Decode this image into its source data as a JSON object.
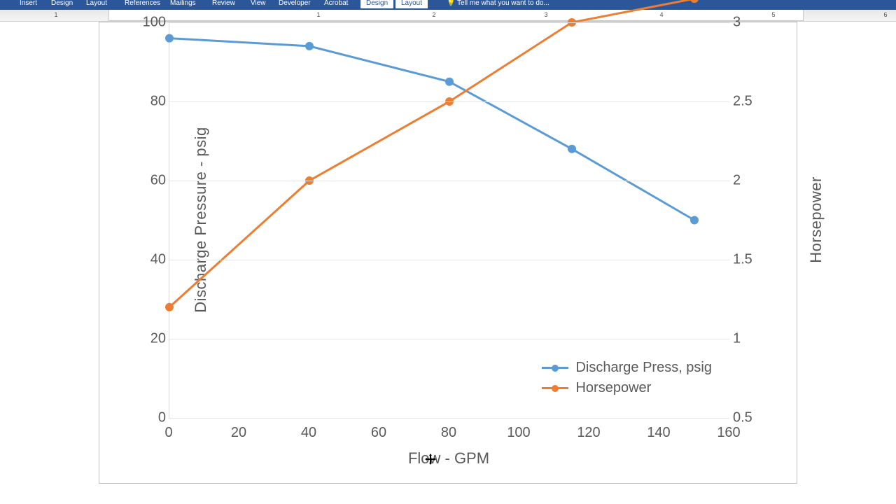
{
  "ribbon": {
    "tabs": [
      "Insert",
      "Design",
      "Layout",
      "References",
      "Mailings",
      "Review",
      "",
      "View",
      "Developer",
      "Acrobat",
      "",
      "Design",
      "Layout"
    ],
    "active_indices": [
      11,
      12
    ],
    "tell_me": "Tell me what you want to do..."
  },
  "ruler_numbers": [
    "1",
    "1",
    "2",
    "3",
    "4",
    "5",
    "6"
  ],
  "chart_data": {
    "type": "line",
    "x": [
      0,
      40,
      80,
      115,
      150
    ],
    "x_label": "Flow - GPM",
    "x_ticks": [
      0,
      20,
      40,
      60,
      80,
      100,
      120,
      140,
      160
    ],
    "series": [
      {
        "name": "Discharge Press, psig",
        "axis": "left",
        "color": "#5b9bd5",
        "values": [
          96,
          94,
          85,
          68,
          50
        ]
      },
      {
        "name": "Horsepower",
        "axis": "right",
        "color": "#ed7d31",
        "values": [
          1.2,
          2.0,
          2.5,
          3.0,
          3.15
        ]
      }
    ],
    "axes": {
      "left": {
        "title": "Discharge Pressure - psig",
        "min": 0,
        "max": 100,
        "ticks": [
          0,
          20,
          40,
          60,
          80,
          100
        ]
      },
      "right": {
        "title": "Horsepower",
        "min": 0.5,
        "max": 3,
        "ticks": [
          0.5,
          1,
          1.5,
          2,
          2.5,
          3
        ]
      }
    },
    "legend_position": "bottom-right-inside"
  }
}
